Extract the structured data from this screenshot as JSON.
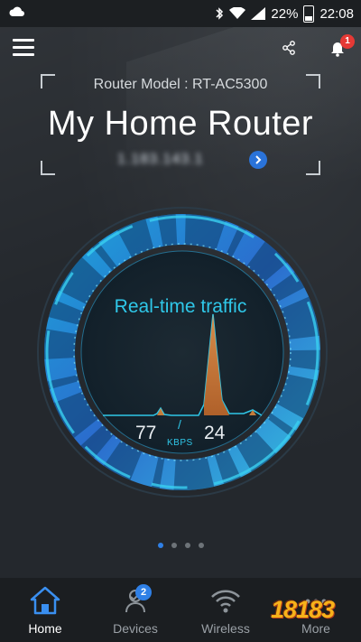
{
  "status_bar": {
    "battery": "22%",
    "time": "22:08",
    "icons": [
      "cloud-icon",
      "bluetooth-icon",
      "wifi-icon",
      "signal-icon",
      "battery-icon"
    ]
  },
  "app_bar": {
    "menu_icon": "hamburger-icon",
    "share_icon": "share-icon",
    "notification_icon": "bell-icon",
    "notification_count": "1"
  },
  "router": {
    "model_line": "Router Model : RT-AC5300",
    "name": "My Home Router",
    "ip_blurred": "1.183.143.1"
  },
  "traffic": {
    "title": "Real-time traffic",
    "upload": "77",
    "download": "24",
    "separator": "/",
    "unit": "KBPS"
  },
  "pager": {
    "pages": 4,
    "active": 0
  },
  "bottom_nav": {
    "items": [
      {
        "label": "Home",
        "icon": "home-icon",
        "active": true
      },
      {
        "label": "Devices",
        "icon": "devices-icon",
        "badge": "2"
      },
      {
        "label": "Wireless",
        "icon": "wifi-icon"
      },
      {
        "label": "More",
        "icon": "more-icon"
      }
    ]
  },
  "watermark": "18183",
  "colors": {
    "accent_blue": "#2f80e6",
    "traffic_cyan": "#2fc7e8",
    "peak_orange": "#d8863c",
    "badge_red": "#e53935"
  }
}
